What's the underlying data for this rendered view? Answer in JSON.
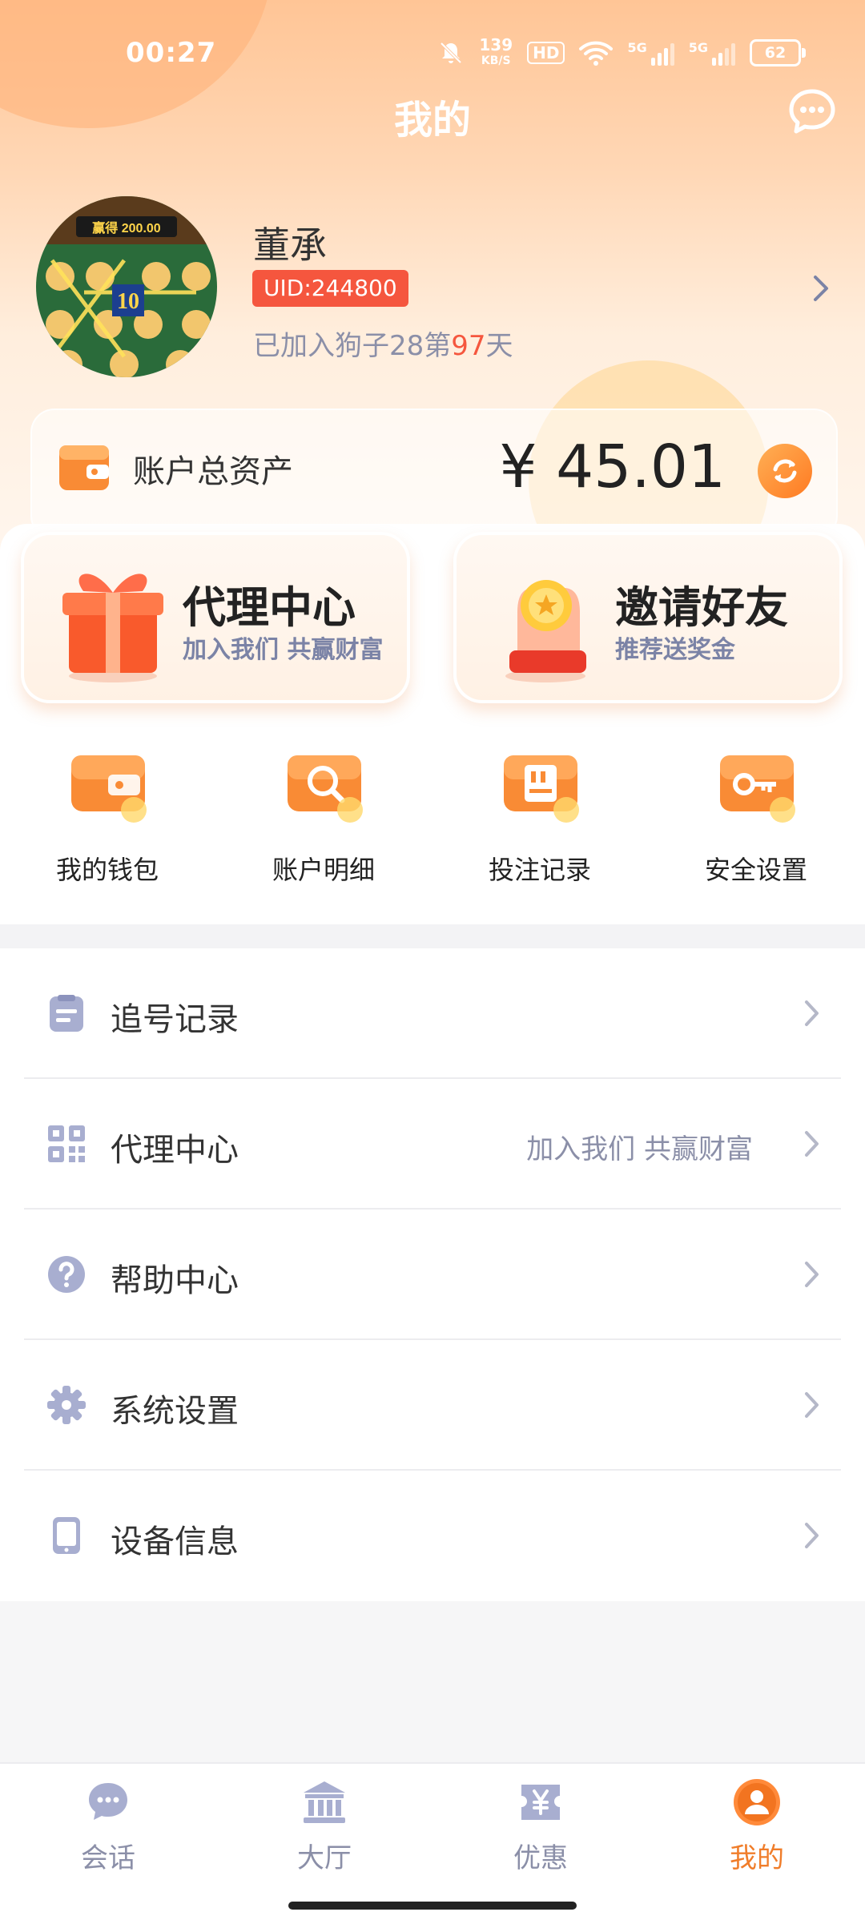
{
  "status_bar": {
    "time": "00:27",
    "net_speed": "139",
    "net_unit": "KB/S",
    "hd": "HD",
    "sim1": "5G",
    "sim2": "5G",
    "battery": "62"
  },
  "header": {
    "title": "我的"
  },
  "profile": {
    "name": "董承",
    "uid": "UID:244800",
    "joined_prefix": "已加入狗子28第",
    "joined_days": "97",
    "joined_suffix": "天"
  },
  "assets": {
    "label": "账户总资产",
    "value": "¥ 45.01"
  },
  "promos": [
    {
      "title": "代理中心",
      "subtitle": "加入我们 共赢财富"
    },
    {
      "title": "邀请好友",
      "subtitle": "推荐送奖金"
    }
  ],
  "quick_actions": [
    {
      "label": "我的钱包",
      "icon": "wallet-icon"
    },
    {
      "label": "账户明细",
      "icon": "search-icon"
    },
    {
      "label": "投注记录",
      "icon": "record-icon"
    },
    {
      "label": "安全设置",
      "icon": "key-icon"
    }
  ],
  "menu": [
    {
      "label": "追号记录",
      "extra": "",
      "icon": "clipboard-icon"
    },
    {
      "label": "代理中心",
      "extra": "加入我们 共赢财富",
      "icon": "qrcode-icon"
    },
    {
      "label": "帮助中心",
      "extra": "",
      "icon": "help-icon"
    },
    {
      "label": "系统设置",
      "extra": "",
      "icon": "gear-icon"
    },
    {
      "label": "设备信息",
      "extra": "",
      "icon": "device-icon"
    }
  ],
  "bottom_nav": [
    {
      "label": "会话",
      "icon": "chat-icon"
    },
    {
      "label": "大厅",
      "icon": "hall-icon"
    },
    {
      "label": "优惠",
      "icon": "coupon-icon"
    },
    {
      "label": "我的",
      "icon": "user-icon",
      "active": true
    }
  ],
  "colors": {
    "accent": "#f07d2a",
    "uid_badge": "#f5563e",
    "muted": "#8b8fa8"
  }
}
